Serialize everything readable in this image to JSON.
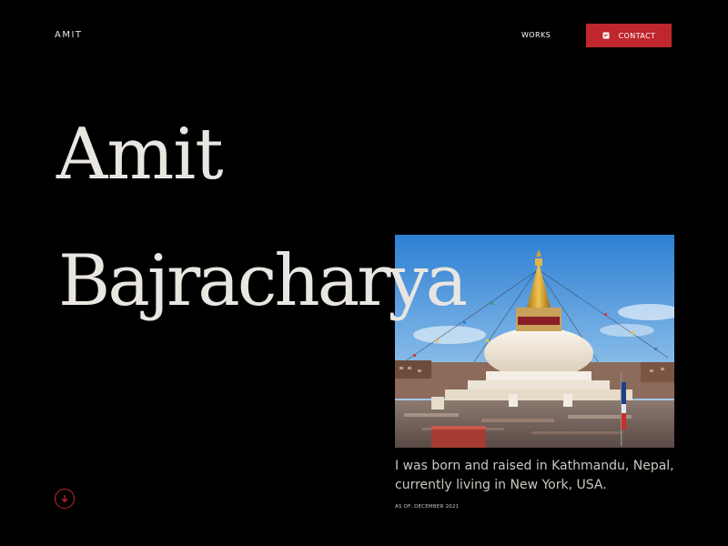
{
  "header": {
    "brand": "AMIT",
    "nav_works": "WORKS",
    "contact_label": "CONTACT"
  },
  "hero": {
    "name_first": "Amit",
    "name_last": "Bajracharya",
    "bio": "I was born and raised in Kathmandu, Nepal, currently living in New York, USA.",
    "as_of": "AS OF: DECEMBER 2021"
  },
  "icons": {
    "contact": "mail-icon",
    "scroll": "arrow-down-circle-icon"
  },
  "colors": {
    "background": "#000000",
    "text": "#e9e6e2",
    "accent": "#c0272d"
  }
}
